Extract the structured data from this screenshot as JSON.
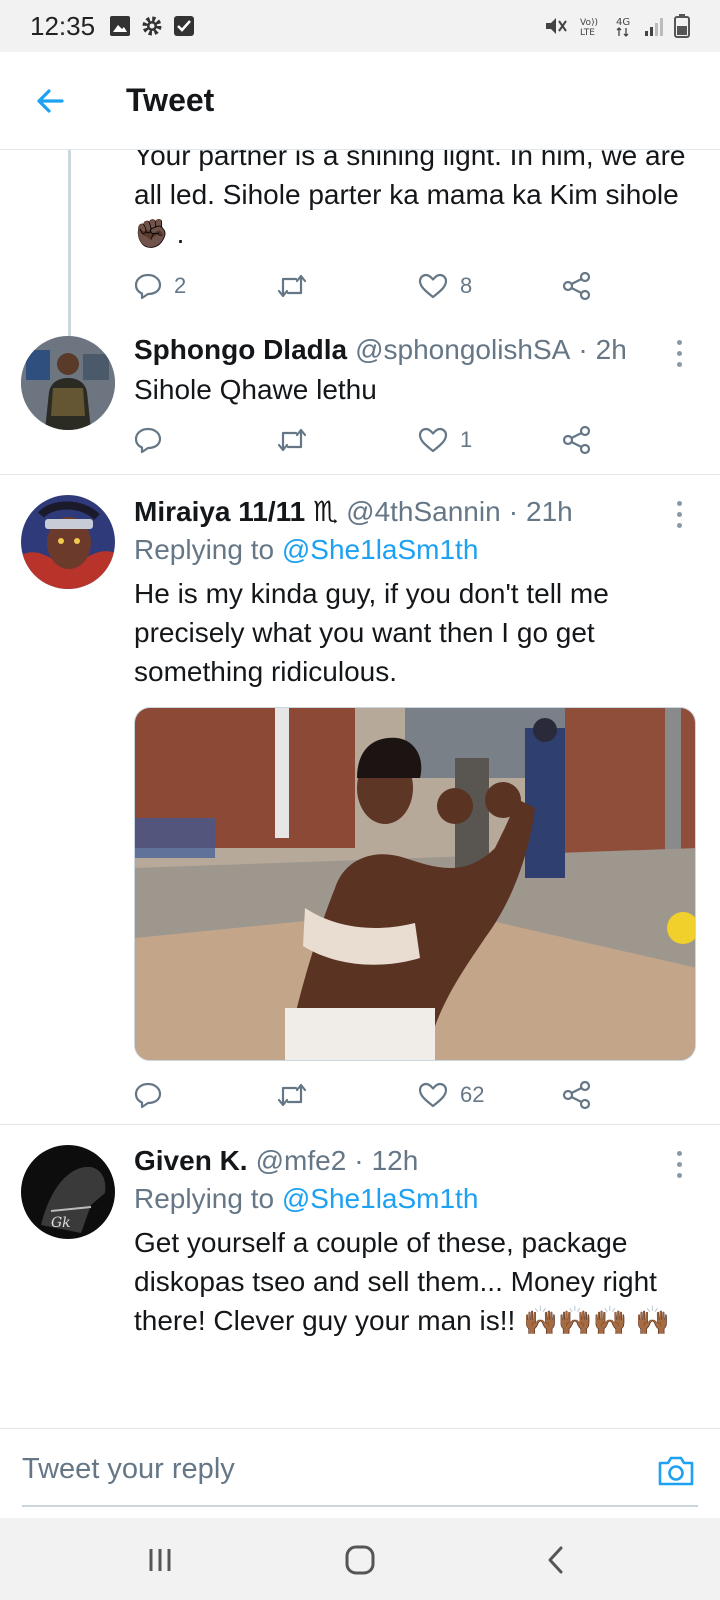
{
  "status": {
    "time": "12:35"
  },
  "header": {
    "title": "Tweet"
  },
  "tweets": [
    {
      "text": "Your partner is a shining light. In him, we are all led. Sihole parter ka mama ka Kim sihole ✊🏿 .",
      "replies": "2",
      "retweets": "",
      "likes": "8"
    },
    {
      "name": "Sphongo Dladla",
      "handle": "@sphongolishSA",
      "time": "2h",
      "text": "Sihole Qhawe lethu",
      "replies": "",
      "retweets": "",
      "likes": "1"
    },
    {
      "name": "Miraiya 11/11 ♏",
      "handle": "@4thSannin",
      "time": "21h",
      "replying_prefix": "Replying to",
      "replying_to": "@She1laSm1th",
      "text": "He is my kinda guy, if you don't tell me precisely what you want then I go get something ridiculous.",
      "replies": "",
      "retweets": "",
      "likes": "62"
    },
    {
      "name": "Given K.",
      "handle": "@mfe2",
      "time": "12h",
      "replying_prefix": "Replying to",
      "replying_to": "@She1laSm1th",
      "text": "Get yourself a couple of these, package diskopas tseo and sell them... Money right there! Clever guy your man is!! 🙌🏾🙌🏾🙌🏾 🙌🏾"
    }
  ],
  "reply_bar": {
    "placeholder": "Tweet your reply"
  },
  "colors": {
    "accent": "#1da1f2",
    "secondary_text": "#657786",
    "divider": "#e1e8ed"
  },
  "icons": [
    "back-arrow-icon",
    "reply-icon",
    "retweet-icon",
    "like-icon",
    "share-icon",
    "more-icon",
    "camera-icon"
  ]
}
